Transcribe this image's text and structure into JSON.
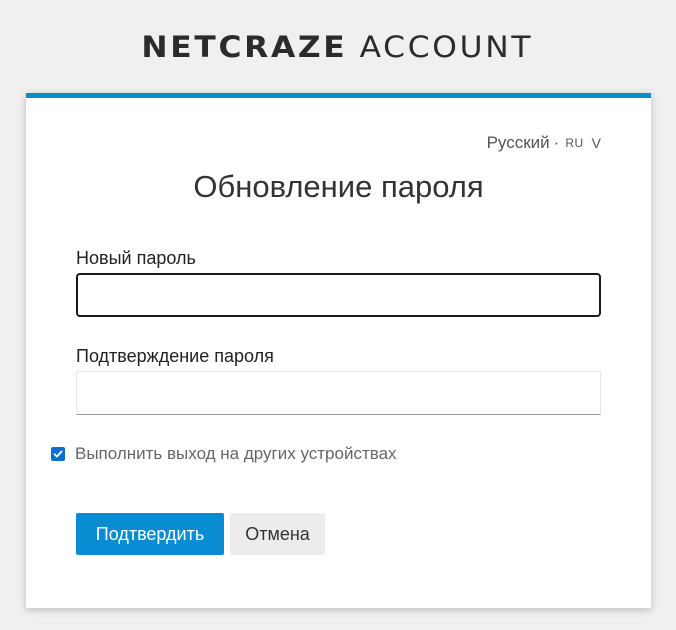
{
  "header": {
    "brand_main": "NETCRAZE",
    "brand_sub": "ACCOUNT"
  },
  "language": {
    "label": "Русский",
    "separator": "·",
    "code": "RU",
    "chevron": "V"
  },
  "form": {
    "title": "Обновление пароля",
    "new_password_label": "Новый пароль",
    "new_password_value": "",
    "confirm_password_label": "Подтверждение пароля",
    "confirm_password_value": "",
    "logout_other_devices_label": "Выполнить выход на других устройствах",
    "logout_other_devices_checked": true,
    "submit_label": "Подтвердить",
    "cancel_label": "Отмена"
  },
  "colors": {
    "accent": "#0a8cd2",
    "checkbox": "#0a6fd1",
    "background": "#f0f0f0"
  }
}
